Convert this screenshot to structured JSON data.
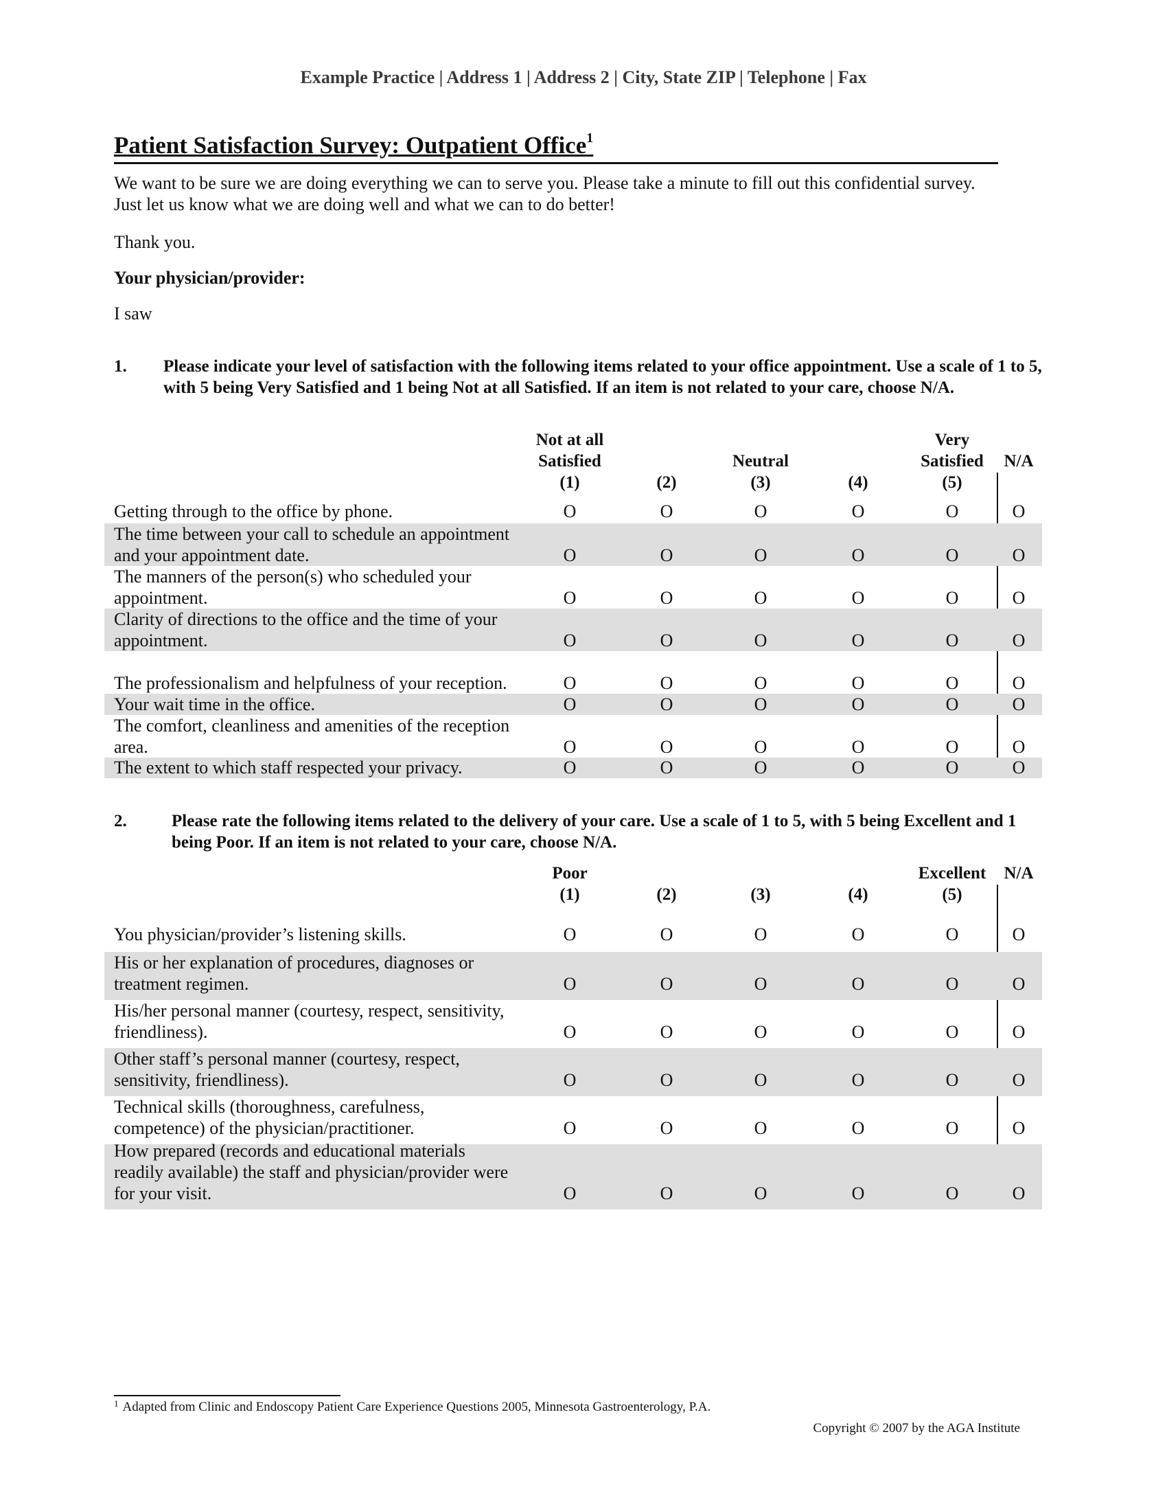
{
  "letterhead": "Example Practice | Address 1 | Address 2 | City, State ZIP | Telephone | Fax",
  "title": "Patient Satisfaction Survey: Outpatient Office",
  "title_footnote_ref": "1",
  "intro": "We want to be sure we are doing everything we can to serve you. Please take a minute to fill out this confidential survey. Just let us know what we are doing well and what we can to do better!",
  "thanks": "Thank you.",
  "provider_label": "Your physician/provider:",
  "provider_saw": "I saw",
  "option_glyph": "O",
  "section1": {
    "number": "1.",
    "instruction": "Please indicate your level of satisfaction with the following items related to your office appointment. Use a scale of 1 to 5, with 5 being Very Satisfied and 1 being Not at all Satisfied. If an item is not related to your care, choose N/A.",
    "headers": {
      "col1_line1": "Not at all",
      "col1_line2": "Satisfied",
      "col1_num": "(1)",
      "col2_num": "(2)",
      "col3_line1": "Neutral",
      "col3_num": "(3)",
      "col4_num": "(4)",
      "col5_line1": "Very",
      "col5_line2": "Satisfied",
      "col5_num": "(5)",
      "na": "N/A"
    },
    "items": [
      "Getting through to the office by phone.",
      "The time between your call to schedule an appointment and your appointment date.",
      "The manners of the person(s) who scheduled your appointment.",
      "Clarity of directions to the office and the time of your appointment.",
      "The professionalism and helpfulness of your reception.",
      "Your wait time in the office.",
      "The comfort, cleanliness and amenities of the reception area.",
      "The extent to which staff respected your privacy."
    ]
  },
  "section2": {
    "number": "2.",
    "instruction": "Please rate the following items related to the delivery of your care. Use a scale of 1 to 5, with 5 being Excellent and 1 being Poor. If an item is not related to your care, choose N/A.",
    "headers": {
      "col1_line1": "Poor",
      "col1_num": "(1)",
      "col2_num": "(2)",
      "col3_num": "(3)",
      "col4_num": "(4)",
      "col5_line1": "Excellent",
      "col5_num": "(5)",
      "na": "N/A"
    },
    "items": [
      "You physician/provider’s listening skills.",
      "His or her explanation of procedures, diagnoses or treatment regimen.",
      "His/her personal manner (courtesy, respect, sensitivity, friendliness).",
      "Other staff’s personal manner (courtesy, respect, sensitivity, friendliness).",
      "Technical skills (thoroughness, carefulness, competence) of the physician/practitioner.",
      "How prepared (records and educational materials readily available) the staff and physician/provider were for your visit."
    ]
  },
  "footnote": {
    "ref": "1",
    "text": "Adapted from Clinic and Endoscopy Patient Care Experience Questions 2005, Minnesota Gastroenterology, P.A."
  },
  "copyright": "Copyright © 2007 by the AGA Institute"
}
